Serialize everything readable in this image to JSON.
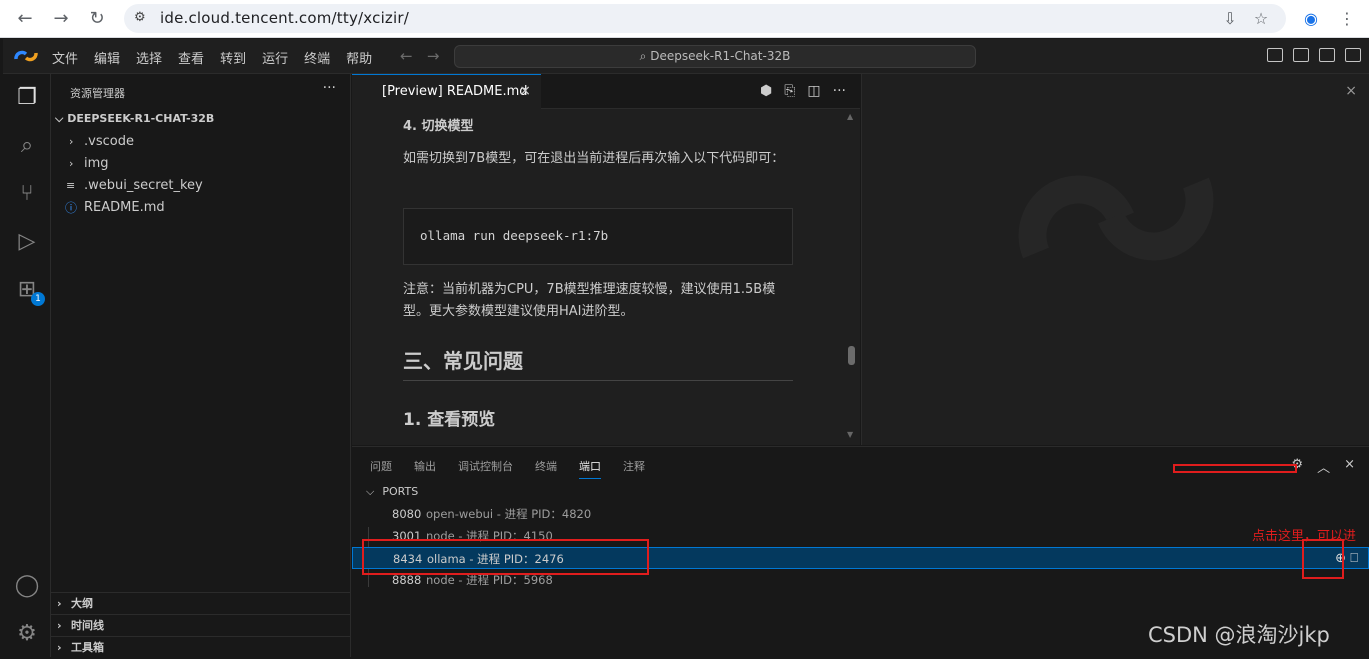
{
  "browser": {
    "url": "ide.cloud.tencent.com/tty/xcizir/"
  },
  "menu": [
    "文件",
    "编辑",
    "选择",
    "查看",
    "转到",
    "运行",
    "终端",
    "帮助"
  ],
  "command_center": "Deepseek-R1-Chat-32B",
  "activity": {
    "extensions_badge": "1"
  },
  "explorer": {
    "title": "资源管理器",
    "more": "···",
    "root": "DEEPSEEK-R1-CHAT-32B",
    "items": [
      {
        "label": ".vscode",
        "kind": "folder"
      },
      {
        "label": "img",
        "kind": "folder"
      },
      {
        "label": ".webui_secret_key",
        "kind": "file"
      },
      {
        "label": "README.md",
        "kind": "info"
      }
    ],
    "sections": [
      "大纲",
      "时间线",
      "工具箱"
    ]
  },
  "editor": {
    "tab_label": "[Preview] README.md",
    "preview": {
      "h4": "4. 切换模型",
      "p1": "如需切换到7B模型，可在退出当前进程后再次输入以下代码即可：",
      "code": "ollama run deepseek-r1:7b",
      "p2": "注意：当前机器为CPU，7B模型推理速度较慢，建议使用1.5B模型。更大参数模型建议使用HAI进阶型。",
      "h2": "三、常见问题",
      "h3": "1. 查看预览"
    }
  },
  "panel": {
    "tabs": [
      "问题",
      "输出",
      "调试控制台",
      "终端",
      "端口",
      "注释"
    ],
    "active_tab": "端口",
    "ports_header": "PORTS",
    "ports": [
      {
        "port": "8080",
        "desc": "open-webui - 进程 PID：4820"
      },
      {
        "port": "3001",
        "desc": "node - 进程 PID：4150"
      },
      {
        "port": "8434",
        "desc": "ollama - 进程 PID：2476"
      },
      {
        "port": "8888",
        "desc": "node - 进程 PID：5968"
      }
    ]
  },
  "annotation": {
    "note": "点击这里，可以进"
  },
  "watermark": "CSDN @浪淘沙jkp",
  "colors": {
    "accent": "#0078d4",
    "annotation_red": "#e01d1d",
    "bg": "#181818"
  }
}
